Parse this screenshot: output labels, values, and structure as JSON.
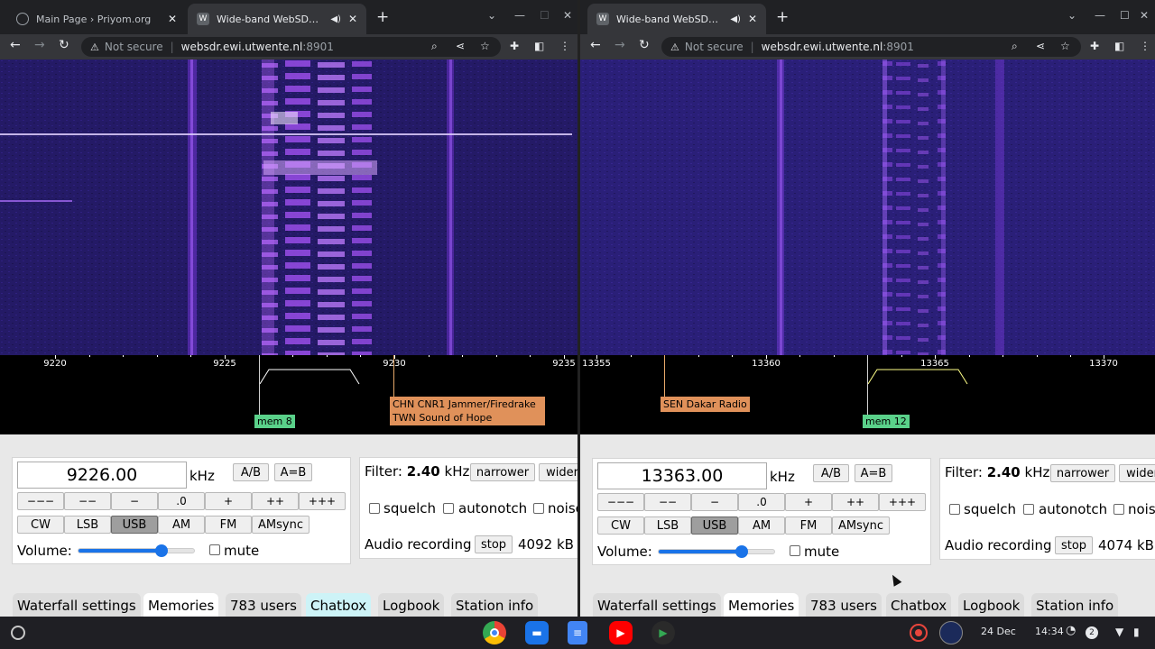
{
  "left": {
    "tabs": [
      {
        "title": "Main Page › Priyom.org",
        "audio": false
      },
      {
        "title": "Wide-band WebSDR in Ensch",
        "audio": true
      }
    ],
    "omnibox": {
      "security": "Not secure",
      "host": "websdr.ewi.utwente.nl",
      "port": ":8901"
    },
    "scale_ticks": [
      "9220",
      "9225",
      "9230",
      "9235"
    ],
    "memory_label": "mem 8",
    "station_label_line1": "CHN CNR1 Jammer/Firedrake",
    "station_label_line2": "TWN Sound of Hope",
    "frequency": "9226.00",
    "unit": "kHz",
    "ab": "A/B",
    "aeqb": "A=B",
    "steps": [
      "−−−",
      "−−",
      "−",
      ".0",
      "+",
      "++",
      "+++"
    ],
    "modes": [
      "CW",
      "LSB",
      "USB",
      "AM",
      "FM",
      "AMsync"
    ],
    "selected_mode": "USB",
    "volume_label": "Volume:",
    "volume_level": 0.72,
    "mute_label": "mute",
    "filter_label": "Filter:",
    "filter_value": "2.40",
    "filter_unit": "kHz",
    "narrower": "narrower",
    "wider": "wider",
    "squelch": "squelch",
    "autonotch": "autonotch",
    "noise": "noise",
    "audio_recording": "Audio recording",
    "stop": "stop",
    "recording_size": "4092 kB",
    "bottom_tabs": [
      "Waterfall settings",
      "Memories",
      "783 users",
      "Chatbox",
      "Logbook",
      "Station info"
    ]
  },
  "right": {
    "tabs": [
      {
        "title": "Wide-band WebSDR in Ensch",
        "audio": true
      }
    ],
    "omnibox": {
      "security": "Not secure",
      "host": "websdr.ewi.utwente.nl",
      "port": ":8901"
    },
    "scale_ticks": [
      "13355",
      "13360",
      "13365",
      "13370"
    ],
    "memory_label": "mem 12",
    "station_label": "SEN Dakar Radio",
    "frequency": "13363.00",
    "unit": "kHz",
    "ab": "A/B",
    "aeqb": "A=B",
    "steps": [
      "−−−",
      "−−",
      "−",
      ".0",
      "+",
      "++",
      "+++"
    ],
    "modes": [
      "CW",
      "LSB",
      "USB",
      "AM",
      "FM",
      "AMsync"
    ],
    "selected_mode": "USB",
    "volume_label": "Volume:",
    "volume_level": 0.72,
    "mute_label": "mute",
    "filter_label": "Filter:",
    "filter_value": "2.40",
    "filter_unit": "kHz",
    "narrower": "narrower",
    "wider": "wider",
    "squelch": "squelch",
    "autonotch": "autonotch",
    "noise": "noise",
    "audio_recording": "Audio recording",
    "stop": "stop",
    "recording_size": "4074 kB",
    "bottom_tabs": [
      "Waterfall settings",
      "Memories",
      "783 users",
      "Chatbox",
      "Logbook",
      "Station info"
    ]
  },
  "shelf": {
    "apps": [
      "chrome-icon",
      "files-icon",
      "docs-icon",
      "youtube-icon",
      "play-store-icon"
    ],
    "date": "24 Dec",
    "time": "14:34",
    "notification_count": "2"
  },
  "colors": {
    "waterfall_bg": "#241a66",
    "signal": "#b060ff",
    "selected_mode": "#9e9e9e",
    "mem_label": "#5ad18a",
    "station_label": "#e0915a"
  }
}
